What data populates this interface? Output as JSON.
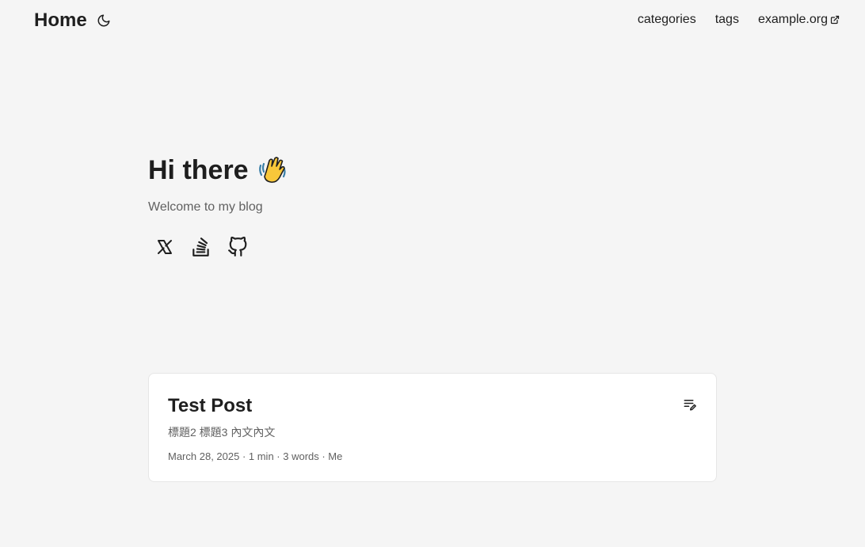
{
  "header": {
    "logo": "Home",
    "theme_icon": "moon-icon",
    "nav": [
      {
        "label": "categories"
      },
      {
        "label": "tags"
      },
      {
        "label": "example.org",
        "icon": "external-link-icon"
      }
    ]
  },
  "hero": {
    "title": "Hi there",
    "emoji_icon": "waving-hand-icon",
    "subtitle": "Welcome to my blog",
    "socials": [
      {
        "icon": "x-icon"
      },
      {
        "icon": "stackoverflow-icon"
      },
      {
        "icon": "github-icon"
      }
    ]
  },
  "posts": [
    {
      "title": "Test Post",
      "summary": "標題2 標題3 內文內文",
      "meta": "March 28, 2025 · 1 min · 3 words · Me",
      "badge_icon": "draft-edit-icon"
    }
  ],
  "colors": {
    "background": "#f5f5f5",
    "card": "#ffffff",
    "text": "#1f1f1f",
    "muted": "#616161",
    "wave_yellow": "#f8c73a"
  }
}
